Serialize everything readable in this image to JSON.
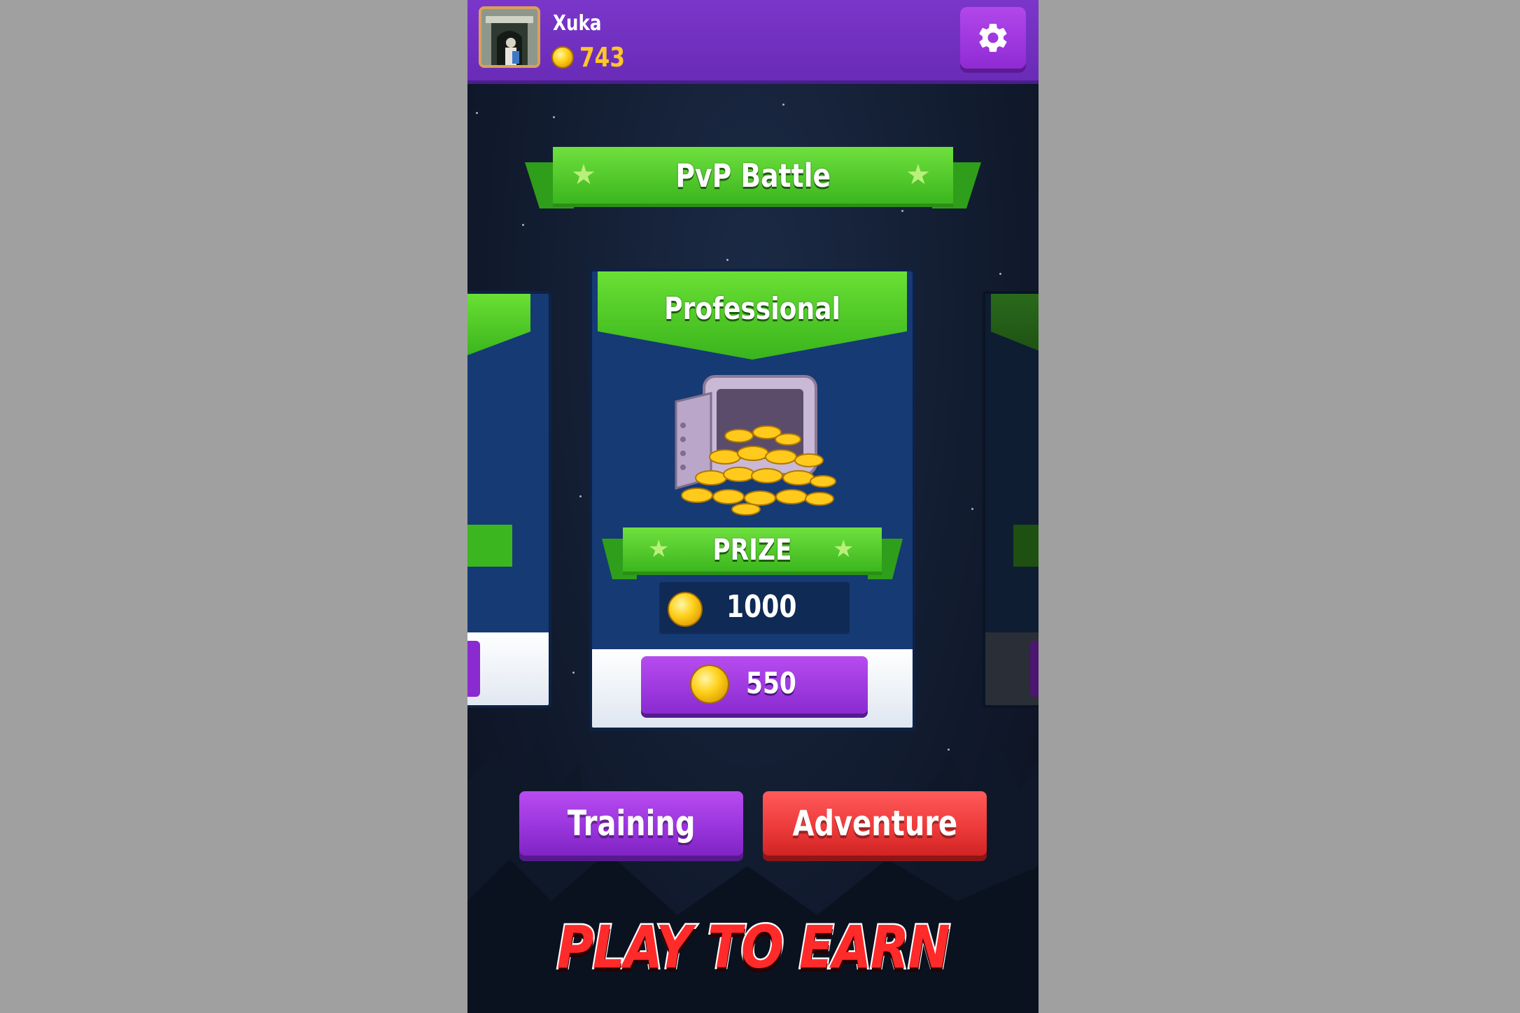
{
  "player": {
    "name": "Xuka",
    "coins": "743"
  },
  "header": {
    "settings_icon": "gear-icon"
  },
  "mode_title": "PvP Battle",
  "cards": {
    "active": {
      "tier": "Professional",
      "prize_label": "PRIZE",
      "prize_amount": "1000",
      "entry_cost": "550",
      "image": "vault-full-of-gold-coins"
    }
  },
  "buttons": {
    "training": "Training",
    "adventure": "Adventure"
  },
  "banner": "PLAY TO EARN",
  "colors": {
    "topbar": "#6a2bb8",
    "accent_green": "#3bb61e",
    "training_purple": "#9a35dd",
    "adventure_red": "#ee3b3b",
    "coin_gold": "#ffc629",
    "banner_red": "#ff2a2a"
  }
}
